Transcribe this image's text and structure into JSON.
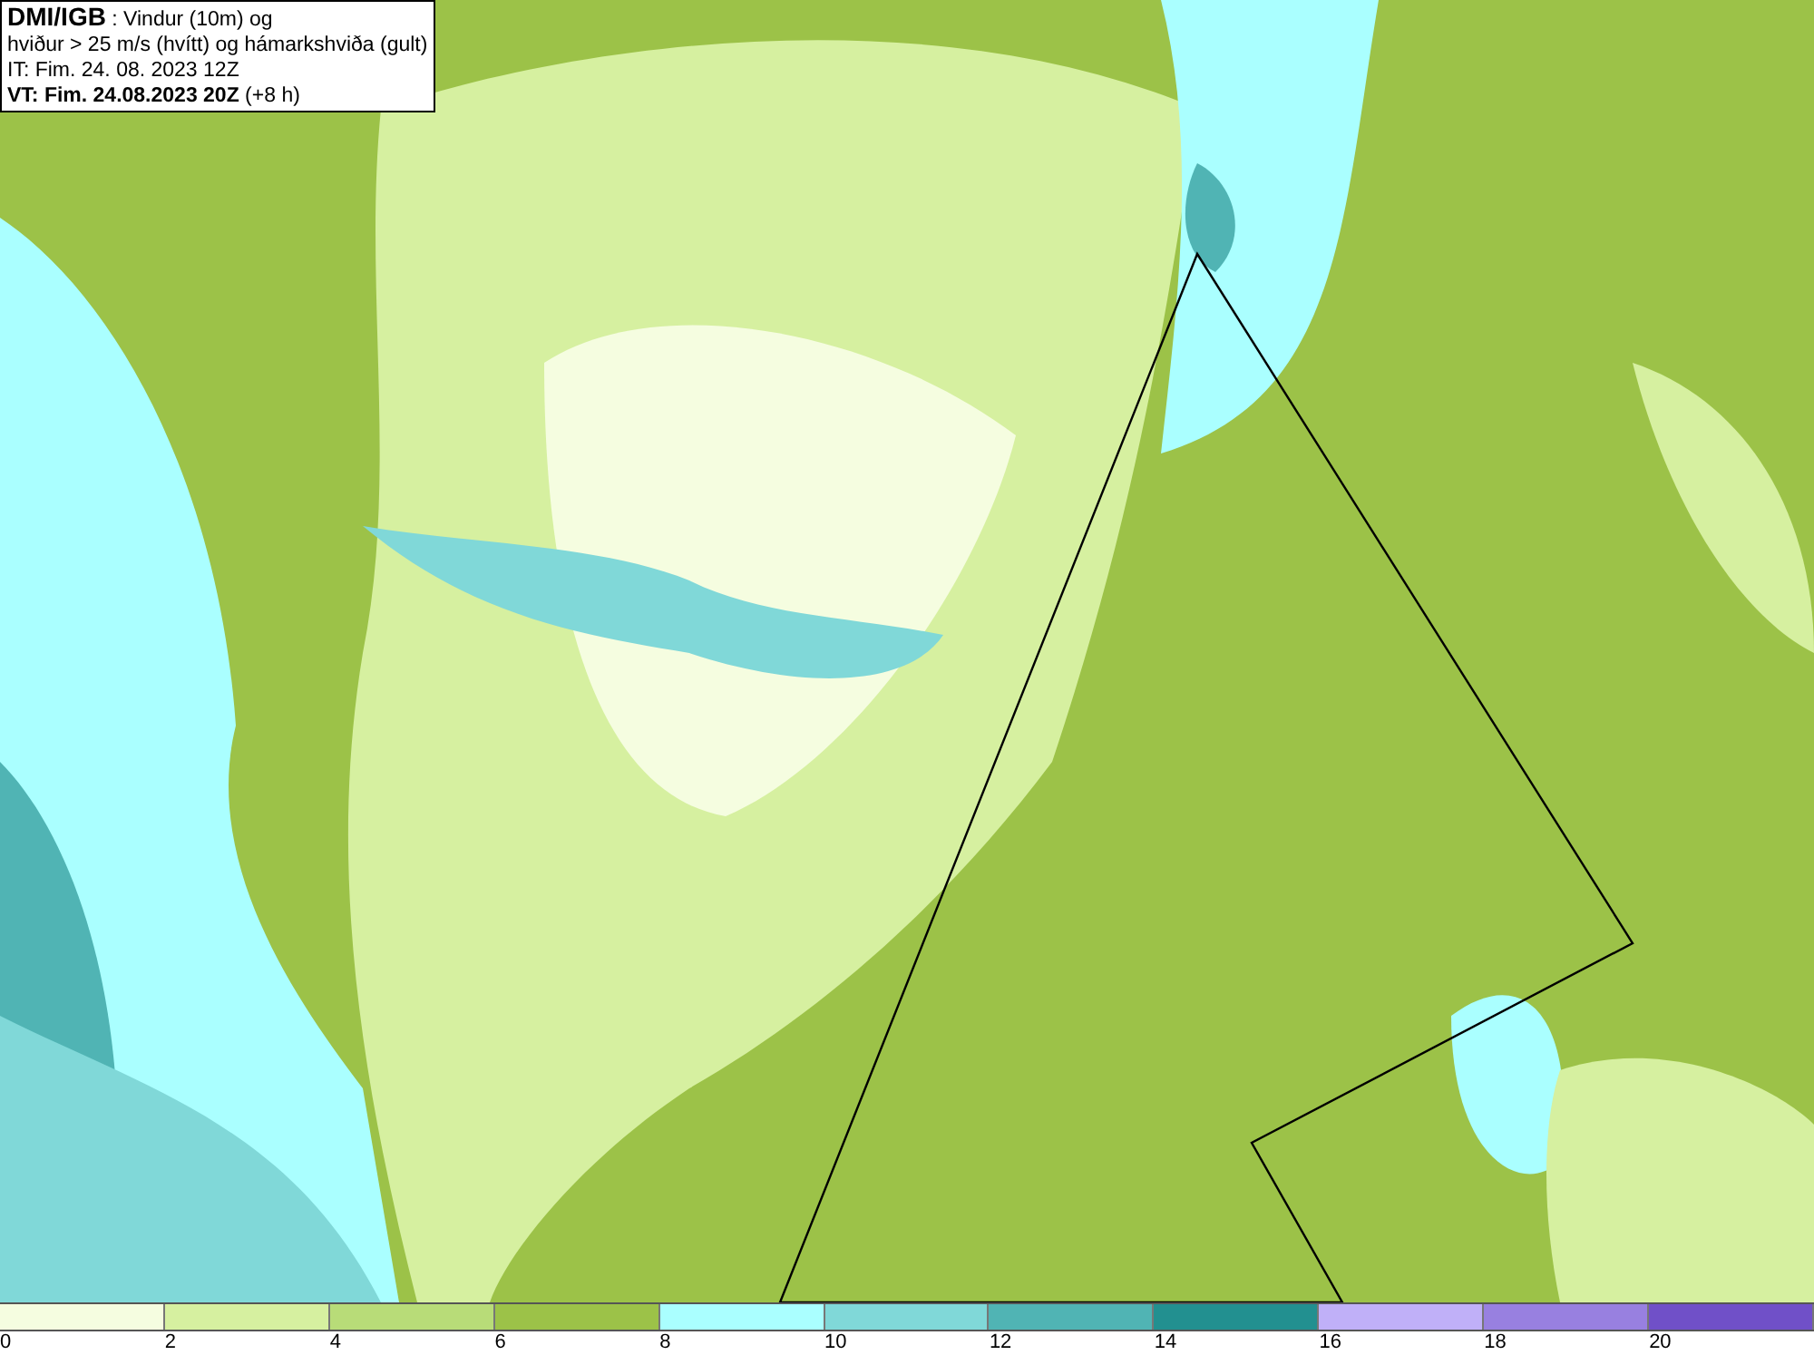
{
  "header": {
    "lines": [
      "**DMI/IGB** : Vindur (10m) og",
      "hviður > 25 m/s (hvítt) og hámarkshviða (gult)",
      "IT: Fim. 24. 08. 2023 12Z",
      "**VT: Fim. 24.08.2023 20Z** (+8 h)"
    ]
  },
  "legend": [
    {
      "color": "#f5fde0",
      "label": "0"
    },
    {
      "color": "#d6f0a0",
      "label": "2"
    },
    {
      "color": "#b8dc78",
      "label": "4"
    },
    {
      "color": "#9cc248",
      "label": "6"
    },
    {
      "color": "#aaffff",
      "label": "8"
    },
    {
      "color": "#80d8d8",
      "label": "10"
    },
    {
      "color": "#50b4b4",
      "label": "12"
    },
    {
      "color": "#229090",
      "label": "14"
    },
    {
      "color": "#c0b0f8",
      "label": "16"
    },
    {
      "color": "#9880e0",
      "label": "18"
    },
    {
      "color": "#7050c8",
      "label": "20"
    }
  ]
}
